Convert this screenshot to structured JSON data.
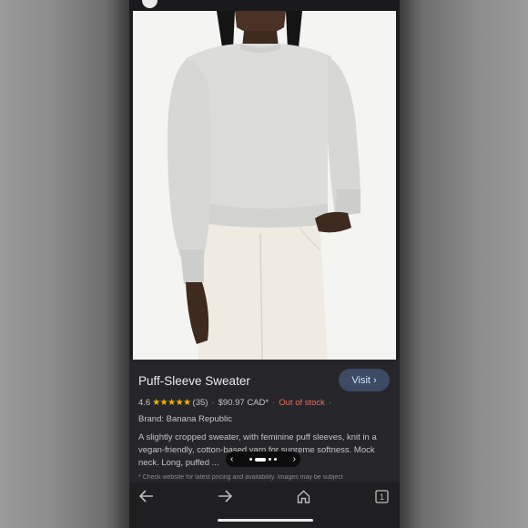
{
  "product": {
    "title": "Puff-Sleeve Sweater",
    "visit_label": "Visit",
    "rating": "4.6",
    "stars": "★★★★★",
    "review_count": "(35)",
    "price": "$90.97 CAD*",
    "stock_status": "Out of stock",
    "brand": "Brand: Banana Republic",
    "description": "A slightly cropped sweater, with feminine puff sleeves, knit in a vegan-friendly, cotton-based yarn for supreme softness. Mock neck. Long, puffed ...",
    "footnote": "* Check website for latest pricing and availability. Images may be subject"
  },
  "pager": {
    "prev": "‹",
    "next": "›",
    "current_index": 2,
    "total": 5
  },
  "colors": {
    "star": "#f4b400",
    "out_of_stock": "#ee6a5d",
    "visit_bg": "#3c4a63"
  },
  "nav": {
    "back_icon": "arrow-left-icon",
    "forward_icon": "arrow-right-icon",
    "home_icon": "home-icon",
    "tabs_icon": "tabs-icon",
    "tab_count": "1"
  }
}
